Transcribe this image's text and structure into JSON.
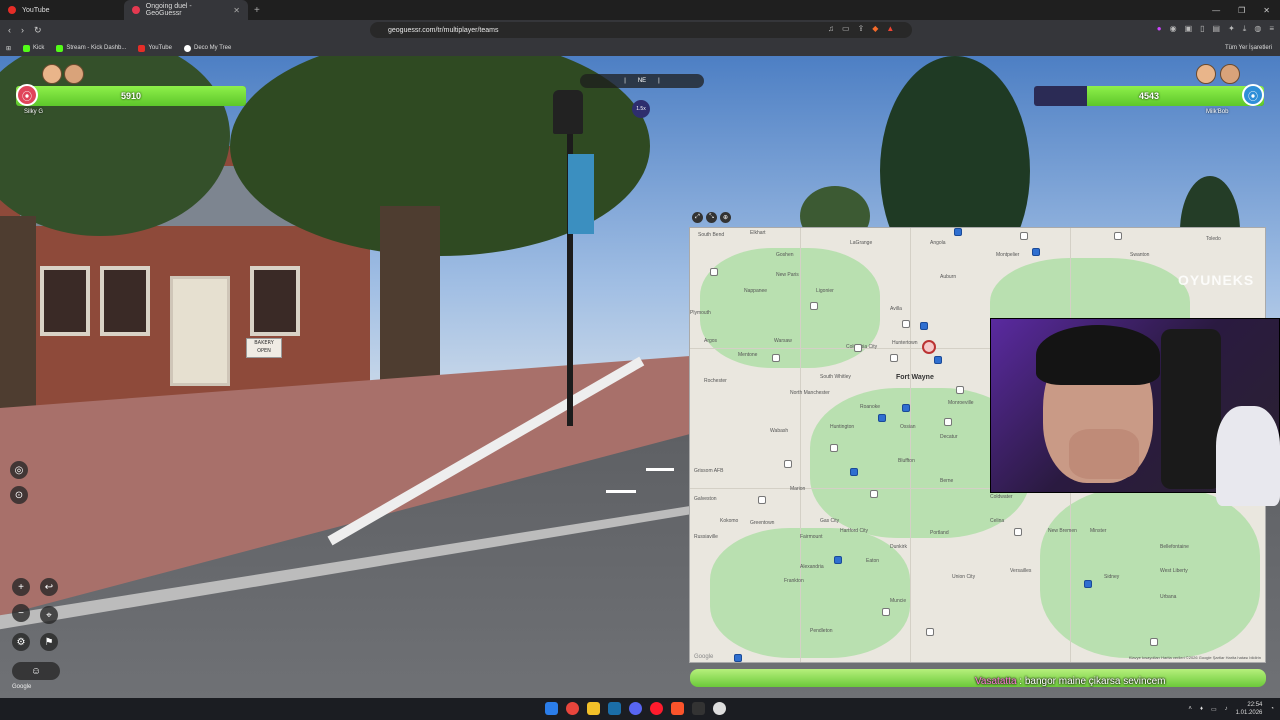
{
  "browser": {
    "tabs": [
      {
        "label": "YouTube",
        "active": false
      },
      {
        "label": "Ongoing duel - GeoGuessr",
        "active": true
      }
    ],
    "url": "geoguessr.com/tr/multiplayer/teams",
    "bookmarks": [
      "Kick",
      "Stream - Kick Dashb...",
      "YouTube",
      "Deco My Tree"
    ],
    "all_bookmarks": "Tüm Yer İşaretleri"
  },
  "game": {
    "left_team": {
      "score": "5910",
      "health_fraction": 1.0,
      "player": "Silky G",
      "color": "#e0445a"
    },
    "right_team": {
      "score": "4543",
      "health_fraction": 0.77,
      "player": "Milk'Bob",
      "color": "#2f8fd8"
    },
    "compass_heading": "NE",
    "zoom_badge": "1.5x",
    "bakery_sign": "BAKERY OPEN",
    "google_watermark": "Google"
  },
  "map": {
    "city": "Fort Wayne",
    "towns": [
      "South Bend",
      "Elkhart",
      "Goshen",
      "LaGrange",
      "Angola",
      "Montpelier",
      "Bryan",
      "Swanton",
      "Toledo",
      "New Paris",
      "Nappanee",
      "Ligonier",
      "Kendallville",
      "Auburn",
      "Avilla",
      "Plymouth",
      "Argos",
      "Warsaw",
      "Columbia City",
      "Huntertown",
      "Mentone",
      "Rochester",
      "North Manchester",
      "South Whitley",
      "New Haven",
      "Monroeville",
      "Roanoke",
      "Huntington",
      "Wabash",
      "Peru",
      "Ossian",
      "Decatur",
      "Bluffton",
      "Berne",
      "Marion",
      "Gas City",
      "Hartford City",
      "Montpelier",
      "Portland",
      "Dunkirk",
      "Celina",
      "Coldwater",
      "Kokomo",
      "Greentown",
      "Russiaville",
      "Fairmount",
      "Alexandria",
      "Eaton",
      "Frankton",
      "Pendleton",
      "Muncie",
      "Union City",
      "Versailles",
      "Sidney",
      "Urbana",
      "West Liberty",
      "Bellefontaine",
      "New Bremen",
      "Minster",
      "Grissom AFB",
      "Galveston"
    ],
    "google_logo": "Google",
    "credits": "Klavye kısayolları  Harita verileri ©2026 Google  Şartlar  Harita hatası bildirin"
  },
  "overlay": {
    "watermark": "OYUNEKS",
    "chat_user": "Vasatatta",
    "chat_text": ": bangor maine çikarsa sevincem"
  },
  "taskbar": {
    "time": "22:54",
    "date": "1.01.2026"
  }
}
